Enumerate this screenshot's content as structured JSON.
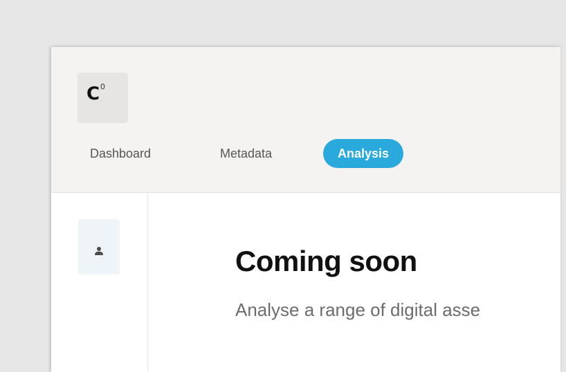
{
  "logo": {
    "text": "C",
    "superscript": "0"
  },
  "nav": {
    "items": [
      {
        "label": "Dashboard",
        "active": false
      },
      {
        "label": "Metadata",
        "active": false
      },
      {
        "label": "Analysis",
        "active": true
      }
    ]
  },
  "sidebar": {
    "items": [
      {
        "icon": "user-icon",
        "active": true
      }
    ]
  },
  "main": {
    "title": "Coming soon",
    "subtitle": "Analyse a range of digital asse"
  },
  "colors": {
    "accent": "#2aa9dd",
    "header_bg": "#f4f3f2",
    "page_bg": "#e6e6e6",
    "sidebar_active_bg": "#eef4f8"
  }
}
